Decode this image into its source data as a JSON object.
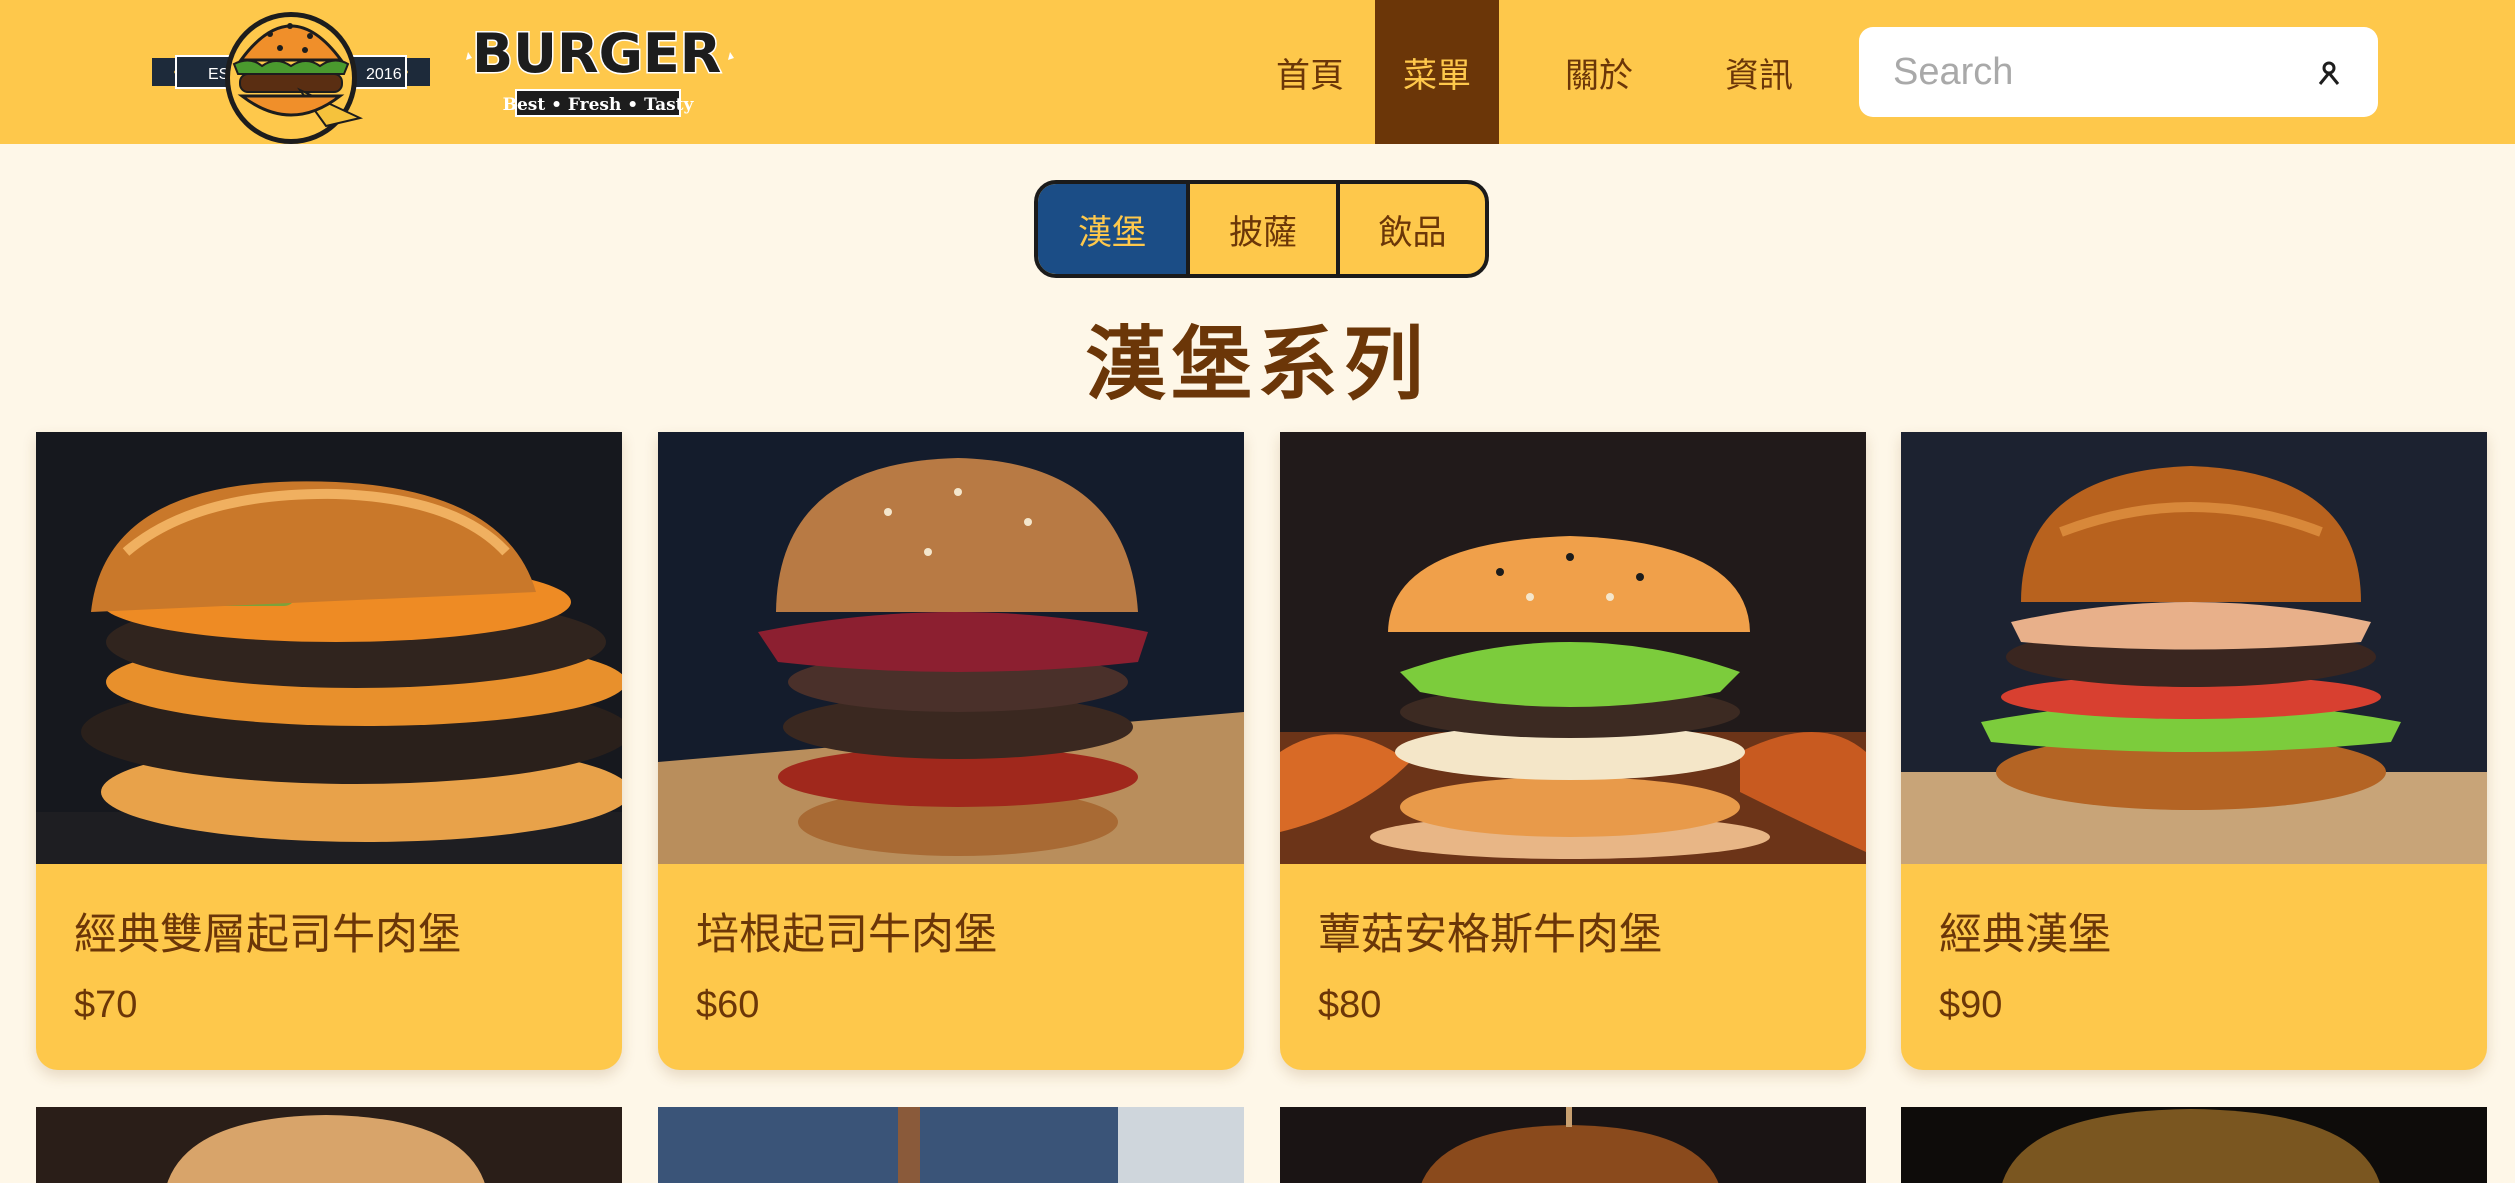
{
  "brand": {
    "wordmark": "BURGER",
    "tagline": "Best • Fresh • Tasty",
    "est_left": "EST.",
    "est_right": "2016"
  },
  "nav": {
    "items": [
      {
        "label": "首頁",
        "active": false
      },
      {
        "label": "菜單",
        "active": true
      },
      {
        "label": "關於",
        "active": false
      },
      {
        "label": "資訊",
        "active": false
      }
    ]
  },
  "search": {
    "placeholder": "Search",
    "value": "",
    "icon": "search-icon"
  },
  "tabs": [
    {
      "label": "漢堡",
      "active": true
    },
    {
      "label": "披薩",
      "active": false
    },
    {
      "label": "飲品",
      "active": false
    }
  ],
  "section_title": "漢堡系列",
  "products": [
    {
      "name": "經典雙層起司牛肉堡",
      "price": "$70"
    },
    {
      "name": "培根起司牛肉堡",
      "price": "$60"
    },
    {
      "name": "蕈菇安格斯牛肉堡",
      "price": "$80"
    },
    {
      "name": "經典漢堡",
      "price": "$90"
    }
  ],
  "colors": {
    "header": "#fec84b",
    "accent_brown": "#6b3608",
    "active_tab": "#1b4d86",
    "page_bg": "#fef7e8"
  }
}
